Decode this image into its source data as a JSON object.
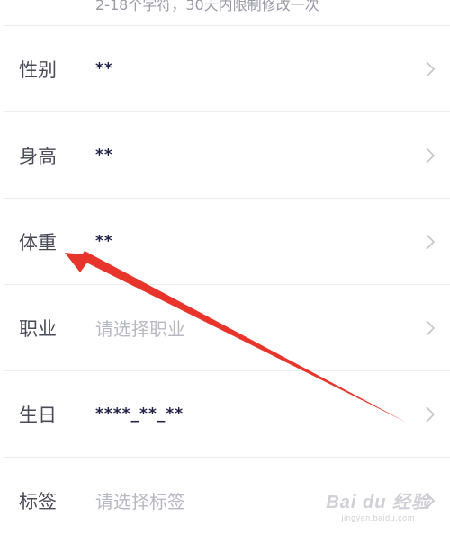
{
  "top_hint": "2-18个字符，30天内限制修改一次",
  "rows": [
    {
      "label": "性别",
      "value": "**",
      "placeholder": false
    },
    {
      "label": "身高",
      "value": "**",
      "placeholder": false
    },
    {
      "label": "体重",
      "value": "**",
      "placeholder": false
    },
    {
      "label": "职业",
      "value": "请选择职业",
      "placeholder": true
    },
    {
      "label": "生日",
      "value": "****_**_**",
      "placeholder": false
    },
    {
      "label": "标签",
      "value": "请选择标签",
      "placeholder": true
    }
  ],
  "icons": {
    "row_chevron": "chevron-right-icon"
  },
  "watermark": {
    "logo": "Bai du 经验",
    "url": "jingyan.baidu.com"
  },
  "colors": {
    "label": "#4a4a58",
    "value": "#23234a",
    "placeholder": "#b8b8c4",
    "annotation_arrow": "#e8352c"
  }
}
